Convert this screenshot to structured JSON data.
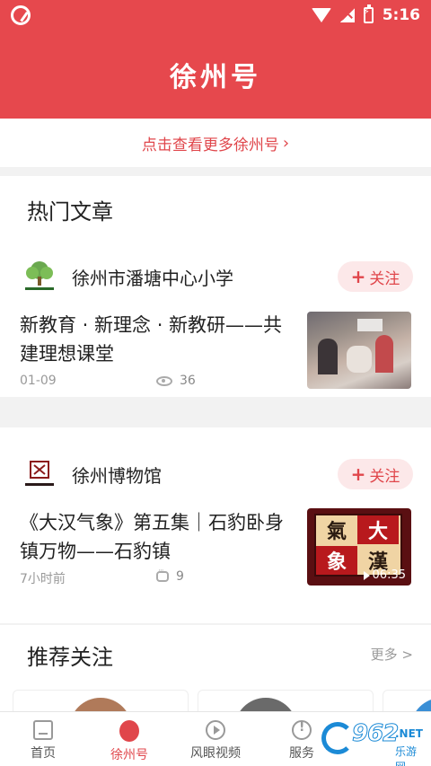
{
  "status_bar": {
    "time": "5:16"
  },
  "header": {
    "title": "徐州号"
  },
  "more_bar": {
    "label": "点击查看更多徐州号",
    "chevron": "›"
  },
  "hot_articles": {
    "title": "热门文章",
    "items": [
      {
        "account": "徐州市潘塘中心小学",
        "follow_label": "关注",
        "article_title": "新教育 · 新理念 · 新教研——共建理想课堂",
        "date": "01-09",
        "count_icon": "eye-icon",
        "count": "36"
      },
      {
        "account": "徐州博物馆",
        "follow_label": "关注",
        "article_title": "《大汉气象》第五集｜石豹卧身镇万物——石豹镇",
        "date": "7小时前",
        "count_icon": "comment-icon",
        "count": "9",
        "video_duration": "06:35",
        "thumb_chars": [
          "氣",
          "大",
          "象",
          "漢"
        ]
      }
    ]
  },
  "recommend": {
    "title": "推荐关注",
    "more_label": "更多 >"
  },
  "bottom_nav": {
    "items": [
      {
        "label": "首页",
        "icon": "home-icon",
        "active": false
      },
      {
        "label": "徐州号",
        "icon": "xuzhou-icon",
        "active": true
      },
      {
        "label": "风眼视频",
        "icon": "play-icon",
        "active": false
      },
      {
        "label": "服务",
        "icon": "service-icon",
        "active": false
      }
    ]
  },
  "watermark": {
    "text": "962",
    "net": ".NET",
    "sub": "乐游网"
  },
  "colors": {
    "brand_red": "#e6484d",
    "follow_bg": "#fce8e9",
    "muted": "#999999"
  }
}
